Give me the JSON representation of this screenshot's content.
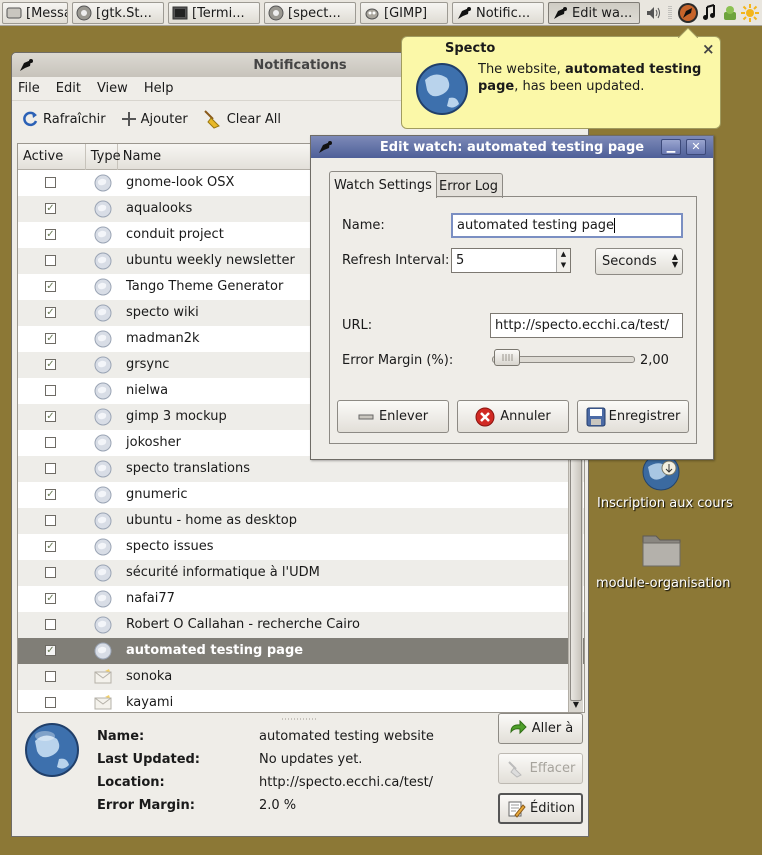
{
  "taskbar": {
    "tasks": [
      {
        "label": "[Messa...",
        "icon": "chat-icon"
      },
      {
        "label": "[gtk.St...",
        "icon": "browser-icon"
      },
      {
        "label": "[Termi...",
        "icon": "terminal-icon"
      },
      {
        "label": "[spect...",
        "icon": "browser-icon"
      },
      {
        "label": "[GIMP]",
        "icon": "gimp-icon"
      },
      {
        "label": "Notific...",
        "icon": "specto-icon"
      },
      {
        "label": "Edit wa...",
        "icon": "specto-icon"
      }
    ],
    "tray_icons": [
      "volume-icon",
      "specto-tray-icon",
      "music-note-icon",
      "update-notifier-icon",
      "weather-sun-icon"
    ]
  },
  "notification": {
    "title": "Specto",
    "text_before": "The website, ",
    "text_bold": "automated testing page",
    "text_after": ", has been updated.",
    "close_glyph": "×"
  },
  "notifications_window": {
    "title": "Notifications",
    "menu": [
      "File",
      "Edit",
      "View",
      "Help"
    ],
    "toolbar": {
      "refresh": "Rafraîchir",
      "add": "Ajouter",
      "clear": "Clear All"
    },
    "columns": [
      "Active",
      "Type",
      "Name"
    ],
    "rows": [
      {
        "name": "gnome-look OSX",
        "active": false,
        "type": "globe"
      },
      {
        "name": "aqualooks",
        "active": true,
        "type": "globe"
      },
      {
        "name": "conduit project",
        "active": true,
        "type": "globe"
      },
      {
        "name": "ubuntu weekly newsletter",
        "active": false,
        "type": "globe"
      },
      {
        "name": "Tango Theme Generator",
        "active": true,
        "type": "globe"
      },
      {
        "name": "specto wiki",
        "active": true,
        "type": "globe"
      },
      {
        "name": "madman2k",
        "active": true,
        "type": "globe"
      },
      {
        "name": "grsync",
        "active": true,
        "type": "globe"
      },
      {
        "name": "nielwa",
        "active": false,
        "type": "globe"
      },
      {
        "name": "gimp 3 mockup",
        "active": true,
        "type": "globe"
      },
      {
        "name": "jokosher",
        "active": false,
        "type": "globe"
      },
      {
        "name": "specto translations",
        "active": false,
        "type": "globe"
      },
      {
        "name": "gnumeric",
        "active": true,
        "type": "globe"
      },
      {
        "name": "ubuntu - home as desktop",
        "active": false,
        "type": "globe"
      },
      {
        "name": "specto issues",
        "active": true,
        "type": "globe"
      },
      {
        "name": "sécurité informatique à l'UDM",
        "active": false,
        "type": "globe"
      },
      {
        "name": "nafai77",
        "active": true,
        "type": "globe"
      },
      {
        "name": "Robert O Callahan - recherche Cairo",
        "active": false,
        "type": "globe"
      },
      {
        "name": "automated testing page",
        "active": true,
        "type": "globe",
        "selected": true
      },
      {
        "name": "sonoka",
        "active": false,
        "type": "mail"
      },
      {
        "name": "kayami",
        "active": false,
        "type": "mail"
      }
    ],
    "details": {
      "labels": [
        "Name:",
        "Last Updated:",
        "Location:",
        "Error Margin:"
      ],
      "values": [
        "automated testing website",
        "No updates yet.",
        "http://specto.ecchi.ca/test/",
        "2.0 %"
      ]
    },
    "buttons": {
      "goto": "Aller à",
      "clear": "Effacer",
      "edit": "Édition"
    }
  },
  "edit_window": {
    "title": "Edit watch: automated testing page",
    "tabs": [
      "Watch Settings",
      "Error Log"
    ],
    "labels": {
      "name": "Name:",
      "interval": "Refresh Interval:",
      "url": "URL:",
      "margin": "Error Margin (%):"
    },
    "values": {
      "name": "automated testing page",
      "interval": "5",
      "unit": "Seconds",
      "url": "http://specto.ecchi.ca/test/",
      "margin": "2,00",
      "margin_fraction": 0.02
    },
    "buttons": {
      "remove": "Enlever",
      "cancel": "Annuler",
      "save": "Enregistrer"
    }
  },
  "desktop_icons": [
    "Inscription aux cours",
    "module-organisation"
  ]
}
